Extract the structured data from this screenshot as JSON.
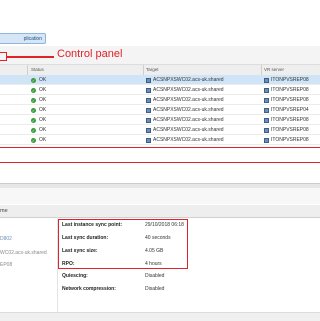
{
  "toolbar": {
    "tab_label": "plication"
  },
  "annotation": {
    "control_panel_label": "Control panel"
  },
  "grid": {
    "columns": {
      "status": "Status",
      "target": "Target",
      "vr_server": "VR server"
    },
    "rows": [
      {
        "status": "OK",
        "target": "ACSNPXSWC02.acs-uk.shared",
        "vr": "ITONPVSREP08",
        "selected": true
      },
      {
        "status": "OK",
        "target": "ACSNPXSWC02.acs-uk.shared",
        "vr": "ITONPVSREP08",
        "selected": false
      },
      {
        "status": "OK",
        "target": "ACSNPXSWC02.acs-uk.shared",
        "vr": "ITONPVSREP08",
        "selected": false
      },
      {
        "status": "OK",
        "target": "ACSNPXSWC02.acs-uk.shared",
        "vr": "ITONPVSREP04",
        "selected": false
      },
      {
        "status": "OK",
        "target": "ACSNPXSWC02.acs-uk.shared",
        "vr": "ITONPVSREP08",
        "selected": false
      },
      {
        "status": "OK",
        "target": "ACSNPXSWC02.acs-uk.shared",
        "vr": "ITONPVSREP08",
        "selected": false
      },
      {
        "status": "OK",
        "target": "ACSNPXSWC02.acs-uk.shared",
        "vr": "ITONPVSREP08",
        "selected": false
      }
    ]
  },
  "details": {
    "panel_title": "me",
    "left_items": [
      "D802",
      "WC02.acs-uk.shared",
      "EP08"
    ],
    "properties": [
      {
        "label": "Last instance sync point:",
        "value": "29/10/2018 06:18"
      },
      {
        "label": "Last sync duration:",
        "value": "40 seconds"
      },
      {
        "label": "Last sync size:",
        "value": "4.05 GB"
      },
      {
        "label": "RPO:",
        "value": "4 hours"
      },
      {
        "label": "Quiescing:",
        "value": "Disabled"
      },
      {
        "label": "Network compression:",
        "value": "Disabled"
      }
    ]
  },
  "colors": {
    "annotation_red": "#e0222a",
    "selected_row": "#cfe4f7",
    "ok_green": "#3a9a3a"
  },
  "icons": {
    "status_ok": "ok-check-icon",
    "server": "server-icon"
  }
}
